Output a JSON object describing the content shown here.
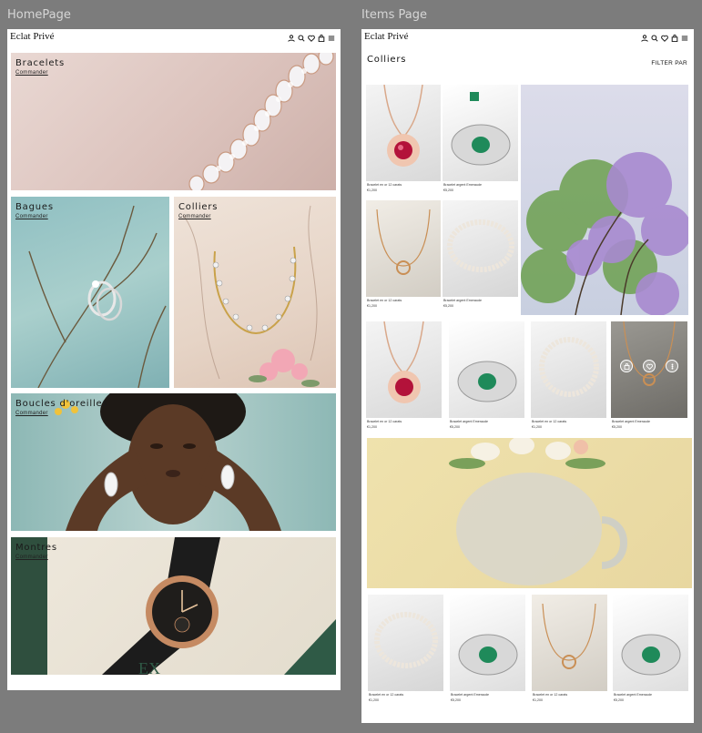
{
  "frames": {
    "home_label": "HomePage",
    "items_label": "Items Page"
  },
  "brand": "Eclat Privé",
  "nav_icons": [
    "user-icon",
    "search-icon",
    "heart-icon",
    "bag-icon",
    "menu-icon"
  ],
  "home": {
    "categories": [
      {
        "name": "Bracelets",
        "cta": "Commander"
      },
      {
        "name": "Bagues",
        "cta": "Commander"
      },
      {
        "name": "Colliers",
        "cta": "Commander"
      },
      {
        "name": "Boucles d'oreilles",
        "cta": "Commander"
      },
      {
        "name": "Montres",
        "cta": "Commander"
      }
    ]
  },
  "items_page": {
    "title": "Colliers",
    "filter_label": "FILTER PAR",
    "products": [
      {
        "name": "Bracelet en or 12 carats",
        "price": "€1,200"
      },
      {
        "name": "Bracelet argent Emeraude",
        "price": "€5,200"
      },
      {
        "name": "Bracelet en or 12 carats",
        "price": "€1,200"
      },
      {
        "name": "Bracelet argent Emeraude",
        "price": "€5,200"
      },
      {
        "name": "Bracelet en or 12 carats",
        "price": "€1,200"
      },
      {
        "name": "Bracelet argent Emeraude",
        "price": "€5,200"
      },
      {
        "name": "Bracelet en or 12 carats",
        "price": "€1,200"
      },
      {
        "name": "Bracelet argent Emeraude",
        "price": "€5,200"
      },
      {
        "name": "Bracelet en or 12 carats",
        "price": "€1,200"
      },
      {
        "name": "Bracelet argent Emeraude",
        "price": "€5,200"
      },
      {
        "name": "Bracelet en or 12 carats",
        "price": "€1,200"
      },
      {
        "name": "Bracelet argent Emeraude",
        "price": "€5,200"
      }
    ],
    "hover_actions": [
      "bag-icon",
      "heart-icon",
      "more-icon"
    ]
  }
}
